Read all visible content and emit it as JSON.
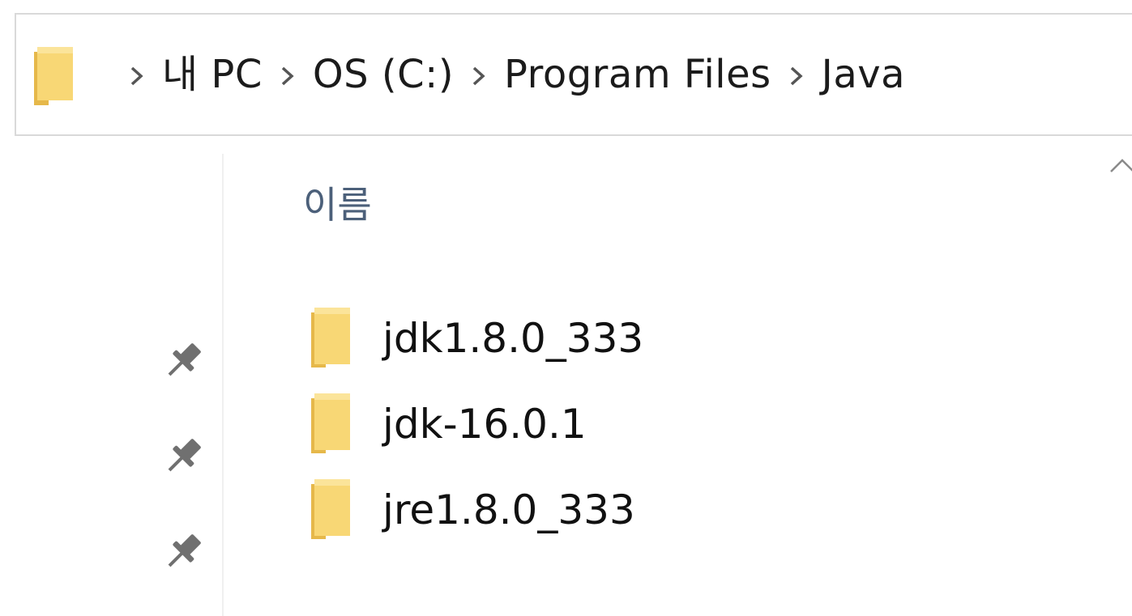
{
  "address_bar": {
    "crumbs": [
      "내 PC",
      "OS (C:)",
      "Program Files",
      "Java"
    ]
  },
  "file_list": {
    "column_header": "이름",
    "items": [
      {
        "name": "jdk1.8.0_333",
        "icon": "folder-icon"
      },
      {
        "name": "jdk-16.0.1",
        "icon": "folder-icon"
      },
      {
        "name": "jre1.8.0_333",
        "icon": "folder-icon"
      }
    ]
  },
  "nav_pane": {
    "pins": [
      "pin-icon",
      "pin-icon",
      "pin-icon"
    ]
  },
  "colors": {
    "folder_light": "#f8d775",
    "folder_dark": "#e6b84a",
    "header_text": "#4c607a",
    "border": "#d9d9d9"
  }
}
